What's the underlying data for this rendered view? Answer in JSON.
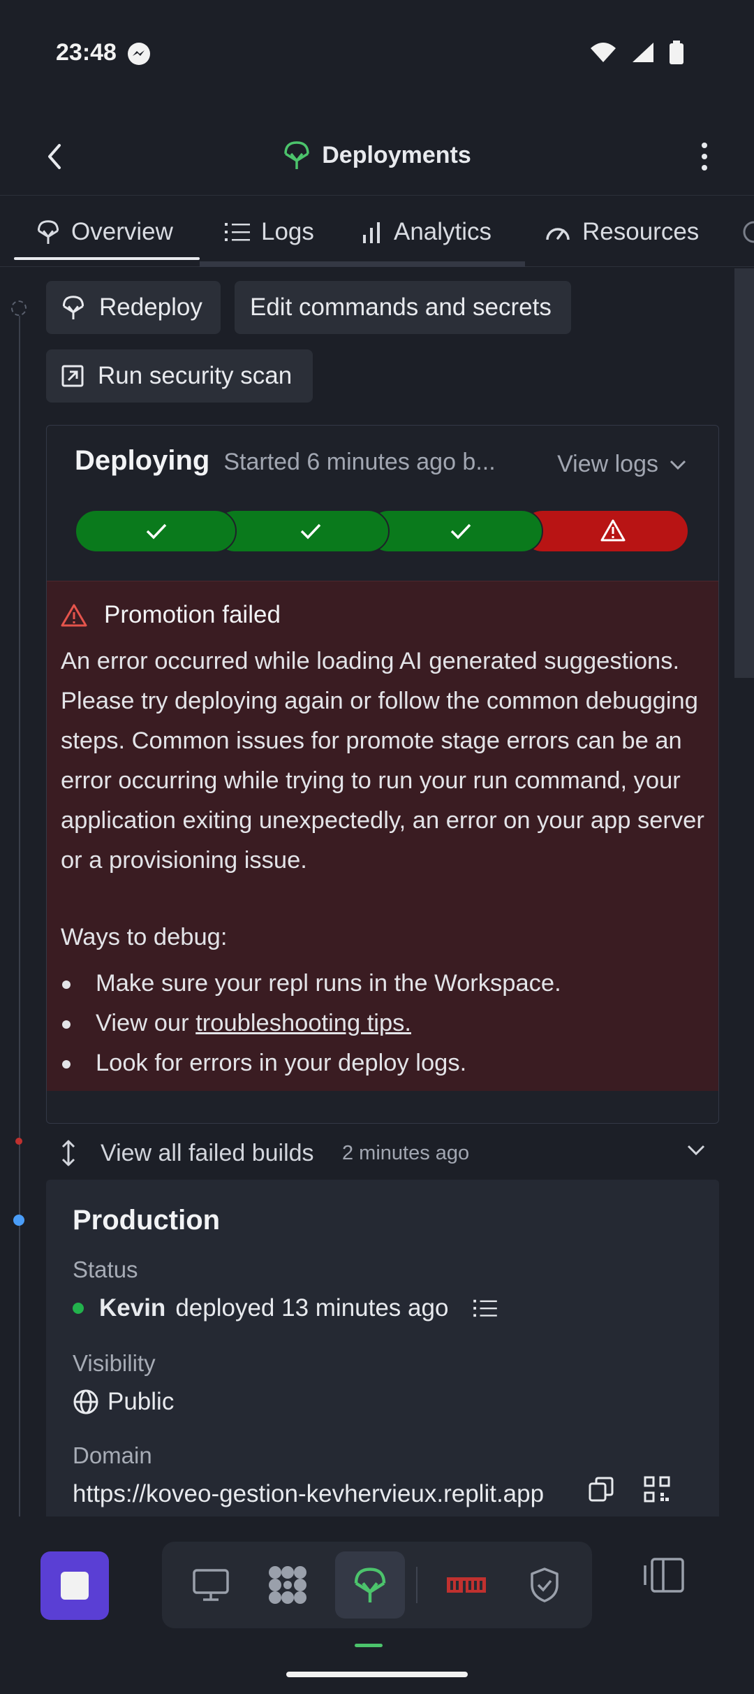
{
  "status_bar": {
    "time": "23:48"
  },
  "app_bar": {
    "title": "Deployments"
  },
  "tabs": [
    {
      "label": "Overview",
      "icon": "deploy-icon"
    },
    {
      "label": "Logs",
      "icon": "list-icon"
    },
    {
      "label": "Analytics",
      "icon": "bar-chart-icon"
    },
    {
      "label": "Resources",
      "icon": "gauge-icon"
    }
  ],
  "actions": {
    "redeploy": "Redeploy",
    "edit_commands": "Edit commands and secrets",
    "security_scan": "Run security scan"
  },
  "deploying": {
    "title": "Deploying",
    "subtitle": "Started 6 minutes ago b...",
    "view_logs": "View logs",
    "stages": [
      "done",
      "done",
      "done",
      "failed"
    ],
    "colors": {
      "done": "#0a7a1c",
      "failed": "#b81414"
    }
  },
  "error": {
    "title": "Promotion failed",
    "body": "An error occurred while loading AI generated suggestions. Please try deploying again or follow the common debugging steps. Common issues for promote stage errors can be an error occurring while trying to run your run command, your application exiting unexpectedly, an error on your app server or a provisioning issue.",
    "ways_label": "Ways to debug:",
    "item1": "Make sure your repl runs in the Workspace.",
    "item2_prefix": "View our ",
    "item2_link": "troubleshooting tips.",
    "item3": "Look for errors in your deploy logs."
  },
  "failed_builds": {
    "label": "View all failed builds",
    "time": "2 minutes ago"
  },
  "production": {
    "title": "Production",
    "status_label": "Status",
    "status_user": "Kevin",
    "status_text": "deployed 13 minutes ago",
    "visibility_label": "Visibility",
    "visibility_value": "Public",
    "domain_label": "Domain",
    "domain_value": "https://koveo-gestion-kevhervieux.replit.app"
  }
}
